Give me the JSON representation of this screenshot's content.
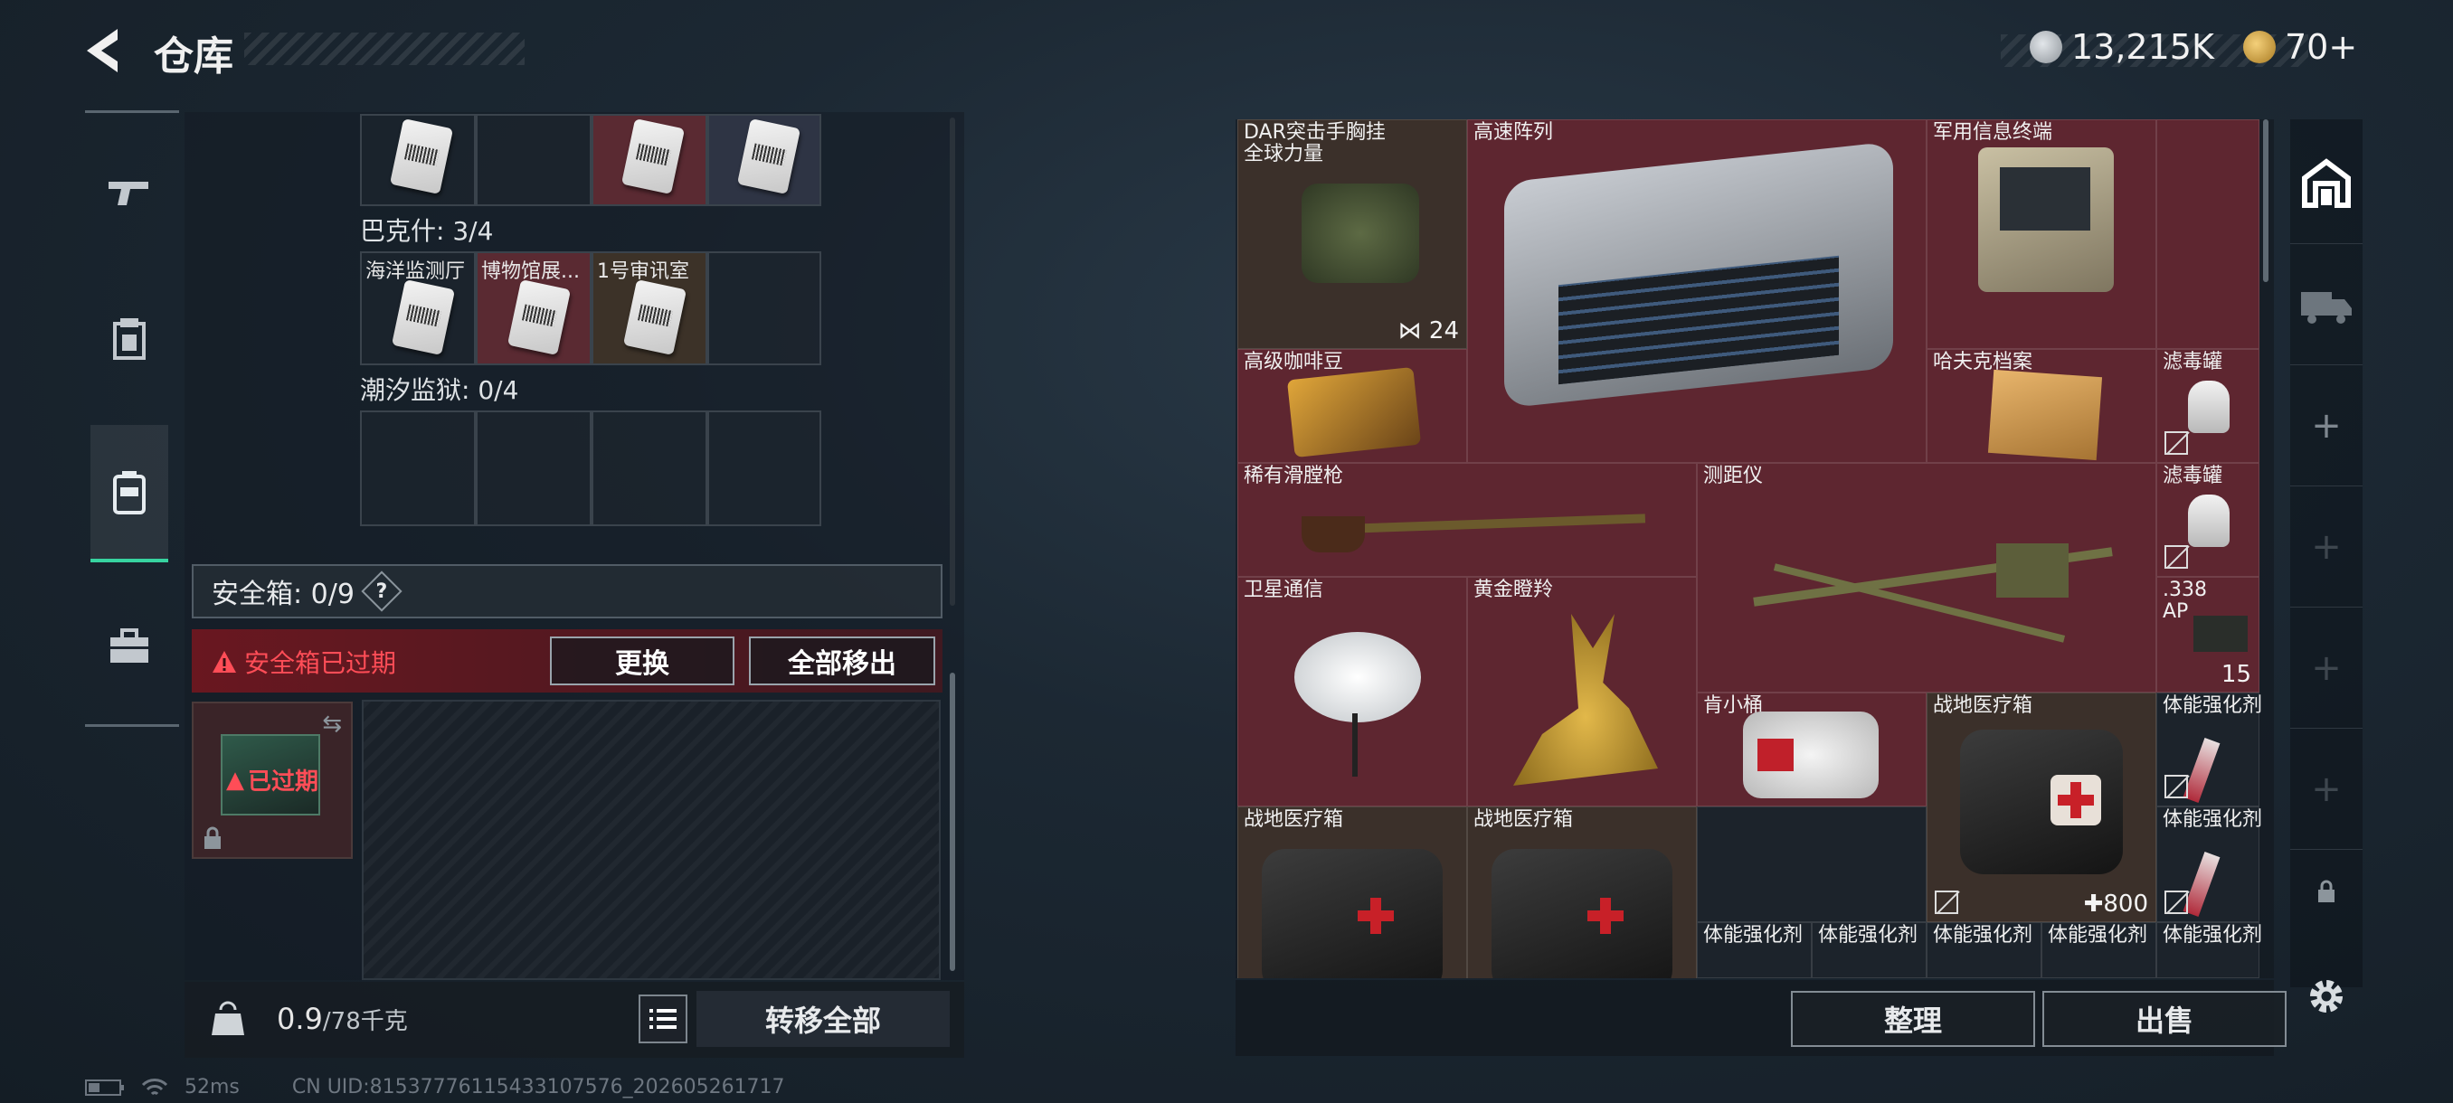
{
  "header": {
    "title": "仓库",
    "currency_1": "13,215K",
    "currency_2": "70+"
  },
  "sidebar": {
    "tabs": [
      "gun-icon",
      "armor-icon",
      "backpack-icon",
      "toolbox-icon"
    ],
    "active_index": 2
  },
  "left_panel": {
    "sections": [
      {
        "label": "巴克什: 3/4",
        "cells": [
          "海洋监测厅",
          "博物馆展...",
          "1号审讯室",
          ""
        ]
      },
      {
        "label": "潮汐监狱: 0/4",
        "cells": [
          "",
          "",
          "",
          ""
        ]
      }
    ],
    "safebox_label": "安全箱: 0/9",
    "help_symbol": "?",
    "expired_text": "安全箱已过期",
    "replace_button": "更换",
    "move_all_button": "全部移出",
    "safebox_item_status": "已过期",
    "weight_value": "0.9",
    "weight_capacity": "/78千克",
    "transfer_all_button": "转移全部"
  },
  "inventory": {
    "items": [
      {
        "name": "DAR突击手胸挂\n全球力量",
        "count": "24"
      },
      {
        "name": "高速阵列",
        "count": ""
      },
      {
        "name": "军用信息终端",
        "count": ""
      },
      {
        "name": "高级咖啡豆",
        "count": ""
      },
      {
        "name": "哈夫克档案",
        "count": ""
      },
      {
        "name": "滤毒罐",
        "count": ""
      },
      {
        "name": "稀有滑膛枪",
        "count": ""
      },
      {
        "name": "测距仪",
        "count": ""
      },
      {
        "name": "滤毒罐",
        "count": ""
      },
      {
        "name": "卫星通信",
        "count": ""
      },
      {
        "name": "黄金瞪羚",
        "count": ""
      },
      {
        "name": ".338\nAP",
        "count": "15"
      },
      {
        "name": "肯小桶",
        "count": ""
      },
      {
        "name": "战地医疗箱",
        "count": "800"
      },
      {
        "name": "体能强化剂",
        "count": ""
      },
      {
        "name": "战地医疗箱",
        "count": ""
      },
      {
        "name": "战地医疗箱",
        "count": ""
      },
      {
        "name": "体能强化剂",
        "count": ""
      },
      {
        "name": "体能强化剂",
        "count": ""
      },
      {
        "name": "体能强化剂",
        "count": ""
      },
      {
        "name": "体能强化剂",
        "count": ""
      },
      {
        "name": "体能强化剂",
        "count": ""
      },
      {
        "name": "体能强化剂",
        "count": ""
      }
    ],
    "sort_button": "整理",
    "sell_button": "出售"
  },
  "status_bar": {
    "ping": "52ms",
    "uid": "CN UID:8153777611543310757​6_202605261717"
  }
}
